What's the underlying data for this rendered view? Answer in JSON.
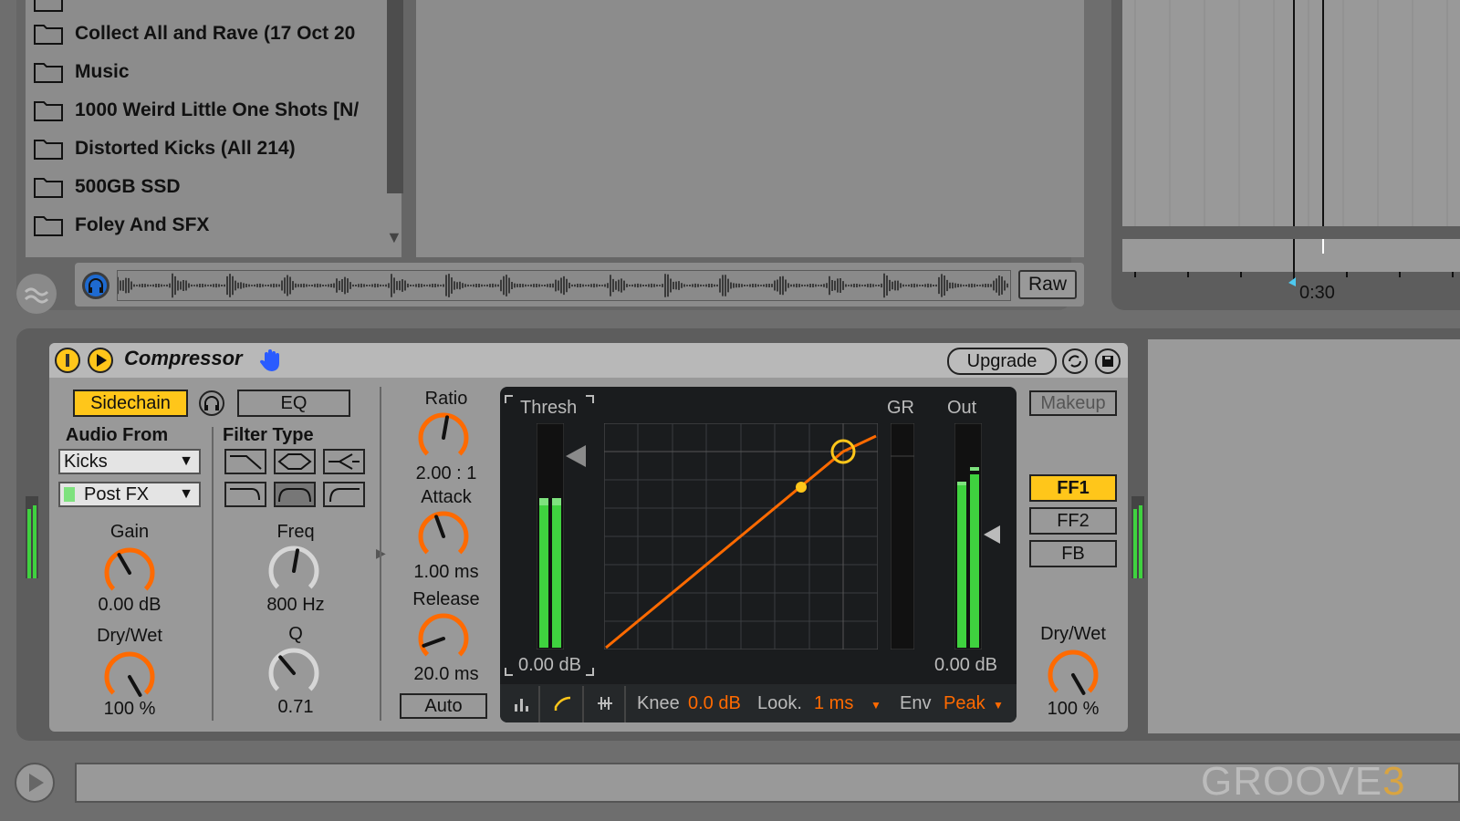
{
  "browser": {
    "items": [
      {
        "label": "Collect All and Rave (17 Oct 20"
      },
      {
        "label": "Music"
      },
      {
        "label": "1000 Weird Little One Shots [N/"
      },
      {
        "label": "Distorted Kicks (All 214)"
      },
      {
        "label": "500GB SSD"
      },
      {
        "label": "Foley And SFX"
      }
    ],
    "raw_label": "Raw"
  },
  "arrangement": {
    "time_label": "0:30"
  },
  "device": {
    "name": "Compressor",
    "upgrade_label": "Upgrade",
    "sidechain": {
      "sidechain_label": "Sidechain",
      "eq_label": "EQ",
      "audio_from_label": "Audio From",
      "audio_from_value": "Kicks",
      "tap_value": "Post FX",
      "gain_label": "Gain",
      "gain_value": "0.00 dB",
      "drywet_label": "Dry/Wet",
      "drywet_value": "100 %"
    },
    "filter": {
      "filter_type_label": "Filter Type",
      "freq_label": "Freq",
      "freq_value": "800 Hz",
      "q_label": "Q",
      "q_value": "0.71"
    },
    "dynamics": {
      "ratio_label": "Ratio",
      "ratio_value": "2.00 : 1",
      "attack_label": "Attack",
      "attack_value": "1.00 ms",
      "release_label": "Release",
      "release_value": "20.0 ms",
      "auto_label": "Auto"
    },
    "display": {
      "thresh_label": "Thresh",
      "thresh_value": "0.00 dB",
      "gr_label": "GR",
      "out_label": "Out",
      "out_value": "0.00 dB",
      "knee_label": "Knee",
      "knee_value": "0.0 dB",
      "look_label": "Look.",
      "look_value": "1 ms",
      "env_label": "Env",
      "env_value": "Peak"
    },
    "right": {
      "makeup_label": "Makeup",
      "ff1_label": "FF1",
      "ff2_label": "FF2",
      "fb_label": "FB",
      "drywet_label": "Dry/Wet",
      "drywet_value": "100 %"
    }
  },
  "branding": {
    "logo_main": "GROOVE",
    "logo_num": "3"
  },
  "colors": {
    "accent_yellow": "#ffc61a",
    "knob_orange": "#ff6a00",
    "meter_green": "#3fd23f"
  }
}
